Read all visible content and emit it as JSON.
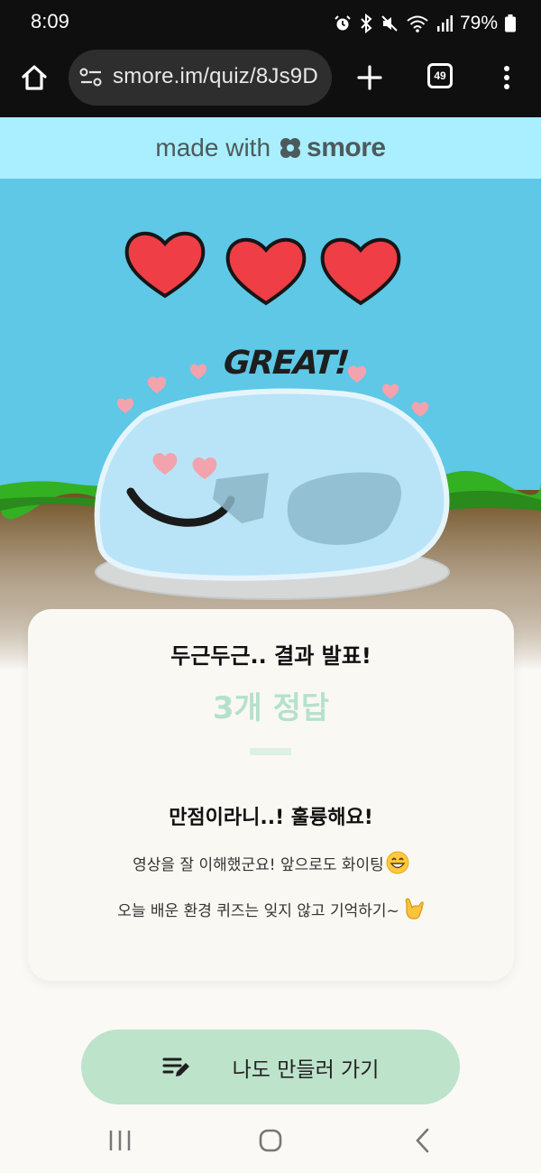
{
  "status_bar": {
    "time": "8:09",
    "battery": "79%",
    "icons": [
      "alarm-icon",
      "bluetooth-icon",
      "mute-icon",
      "wifi-icon",
      "signal-icon",
      "battery-icon"
    ]
  },
  "browser": {
    "url": "smore.im/quiz/8Js9D",
    "tab_count": "49",
    "icons": [
      "home-icon",
      "site-settings-icon",
      "plus-icon",
      "more-vert-icon"
    ]
  },
  "banner": {
    "made_with": "made with",
    "brand": "smore"
  },
  "scene": {
    "great": "GREAT!",
    "hearts": 3,
    "colors": {
      "sky": "#5ec8e6",
      "grass": "#34b023",
      "dirt": "#6f4f22",
      "heart": "#ef3e45",
      "slime": "#b9e4f7"
    }
  },
  "result": {
    "heading": "두근두근.. 결과 발표!",
    "score": "3개 정답",
    "title": "만점이라니..! 훌륭해요!",
    "desc_1": "영상을 잘 이해했군요! 앞으로도 화이팅",
    "desc_1_emoji": "grinning-face-icon",
    "desc_2": "오늘 배운 환경 퀴즈는 잊지 않고 기억하기~",
    "desc_2_emoji": "call-me-hand-icon"
  },
  "cta": {
    "label": "나도 만들러 가기",
    "icon": "edit-list-icon",
    "color": "#bde3cb"
  },
  "nav": {
    "icons": [
      "recents-icon",
      "home-nav-icon",
      "back-icon"
    ]
  }
}
